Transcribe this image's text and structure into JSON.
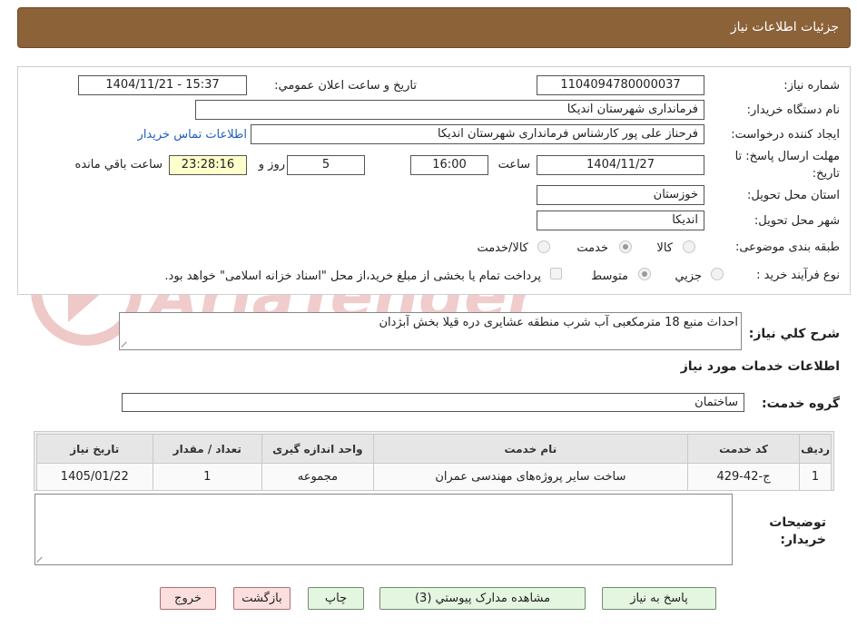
{
  "header": {
    "title": "جزئیات اطلاعات نیاز"
  },
  "labels": {
    "need_number": "شماره نیاز:",
    "announce_datetime": "تاریخ و ساعت اعلان عمومي:",
    "buyer_org": "نام دستگاه خریدار:",
    "requester": "ایجاد کننده درخواست:",
    "deadline_1": "مهلت ارسال پاسخ: تا",
    "deadline_2": "تاریخ:",
    "hour": "ساعت",
    "day_and": "روز و",
    "remaining": "ساعت باقي مانده",
    "province": "استان محل تحویل:",
    "city": "شهر محل تحویل:",
    "category": "طبقه بندی موضوعی:",
    "process": "نوع فرآیند خرید :",
    "description": "شرح کلي نیاز:",
    "services_info": "اطلاعات خدمات مورد نیاز",
    "service_group": "گروه خدمت:",
    "buyer_notes_1": "توضیحات",
    "buyer_notes_2": "خریدار:"
  },
  "values": {
    "need_number": "1104094780000037",
    "announce_datetime": "1404/11/21 - 15:37",
    "buyer_org": "فرمانداری شهرستان اندیکا",
    "requester": "فرحناز علی پور کارشناس فرمانداری شهرستان اندیکا",
    "contact_link": "اطلاعات تماس خریدار",
    "deadline_date": "1404/11/27",
    "deadline_time": "16:00",
    "days": "5",
    "remaining_time": "23:28:16",
    "province": "خوزستان",
    "city": "اندیکا",
    "description": "احداث منبع 18 مترمکعبی آب شرب منطقه عشایری دره قیلا بخش آبژدان",
    "service_group": "ساختمان"
  },
  "category_options": [
    {
      "label": "کالا",
      "selected": false
    },
    {
      "label": "خدمت",
      "selected": true
    },
    {
      "label": "کالا/خدمت",
      "selected": false
    }
  ],
  "process_options": [
    {
      "label": "جزيي",
      "selected": false
    },
    {
      "label": "متوسط",
      "selected": true
    }
  ],
  "process_note": "پرداخت تمام یا بخشی از مبلغ خرید،از محل \"اسناد خزانه اسلامی\" خواهد بود.",
  "table": {
    "headers": [
      "ردیف",
      "کد خدمت",
      "نام خدمت",
      "واحد اندازه گیری",
      "تعداد / مقدار",
      "تاریخ نیاز"
    ],
    "rows": [
      [
        "1",
        "ج-42-429",
        "ساخت سایر پروژه‌های مهندسی عمران",
        "مجموعه",
        "1",
        "1405/01/22"
      ]
    ]
  },
  "buttons": {
    "reply": "پاسخ به نیاز",
    "attachments": "مشاهده مدارک پیوستي (3)",
    "print": "چاپ",
    "back": "بازگشت",
    "exit": "خروج"
  },
  "colors": {
    "header": "#8c6239",
    "link": "#1f5fbf",
    "remaining_bg": "#ffffcc",
    "watermark": "#e8b4b4"
  },
  "watermark_text": "AriaTender.neT"
}
